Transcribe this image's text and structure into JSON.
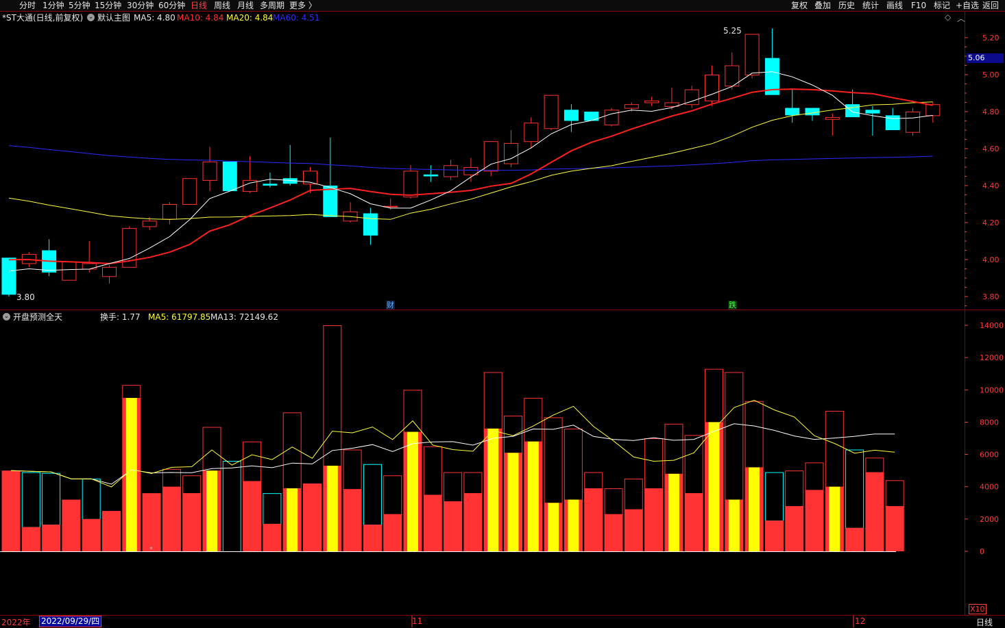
{
  "nav": {
    "periods": [
      "分时",
      "1分钟",
      "5分钟",
      "15分钟",
      "30分钟",
      "60分钟",
      "日线",
      "周线",
      "月线",
      "多周期",
      "更多 〉"
    ],
    "active_period": "日线",
    "tools": [
      "复权",
      "叠加",
      "历史",
      "统计",
      "画线",
      "F10",
      "标记",
      "+自选",
      "返回"
    ]
  },
  "main_info": {
    "title": "*ST大通(日线,前复权)",
    "template": "默认主图",
    "ma5": "MA5: 4.80",
    "ma10": "MA10: 4.84",
    "ma20": "MA20: 4.84",
    "ma60": "MA60: 4.51"
  },
  "sub_info": {
    "indicator": "开盘预测全天",
    "turnover": "换手: 1.77",
    "ma5": "MA5: 61797.85",
    "ma13": "MA13: 72149.62"
  },
  "annotations": {
    "high_label": "5.25",
    "low_label": "3.80",
    "marker_cai": "财",
    "marker_die": "跌",
    "current_price": "5.06",
    "sub_marker": "*"
  },
  "bottom": {
    "year": "2022年",
    "cursor_date": "2022/09/29/四",
    "month_11": "11",
    "month_12": "12",
    "period_label": "日线",
    "zoom": "X10"
  },
  "colors": {
    "up": "#ff3333",
    "down": "#00ffff",
    "ma5": "#ffffff",
    "ma10": "#ff2020",
    "ma20": "#ffff40",
    "ma60": "#2a2aff",
    "axis": "#ff3b3b",
    "yellow_bar": "#ffff00"
  },
  "chart_data": [
    {
      "type": "candlestick",
      "price_axis": {
        "ticks": [
          "5.20",
          "5.00",
          "4.80",
          "4.60",
          "4.40",
          "4.20",
          "4.00",
          "3.80"
        ],
        "range": [
          3.76,
          5.32
        ]
      },
      "candles": [
        [
          4.01,
          4.01,
          3.8,
          3.81
        ],
        [
          3.98,
          4.04,
          3.96,
          4.03
        ],
        [
          4.05,
          4.11,
          3.91,
          3.93
        ],
        [
          3.89,
          3.99,
          3.89,
          3.99
        ],
        [
          3.95,
          4.1,
          3.93,
          3.98
        ],
        [
          3.91,
          3.97,
          3.87,
          3.96
        ],
        [
          3.96,
          4.18,
          3.96,
          4.17
        ],
        [
          4.18,
          4.23,
          4.16,
          4.21
        ],
        [
          4.22,
          4.31,
          4.19,
          4.3
        ],
        [
          4.3,
          4.44,
          4.3,
          4.44
        ],
        [
          4.43,
          4.61,
          4.37,
          4.53
        ],
        [
          4.53,
          4.53,
          4.37,
          4.37
        ],
        [
          4.37,
          4.56,
          4.36,
          4.43
        ],
        [
          4.41,
          4.47,
          4.39,
          4.4
        ],
        [
          4.44,
          4.62,
          4.4,
          4.41
        ],
        [
          4.41,
          4.5,
          4.36,
          4.48
        ],
        [
          4.4,
          4.66,
          4.25,
          4.23
        ],
        [
          4.21,
          4.31,
          4.2,
          4.26
        ],
        [
          4.25,
          4.28,
          4.08,
          4.13
        ],
        [
          4.29,
          4.33,
          4.27,
          4.29
        ],
        [
          4.34,
          4.51,
          4.33,
          4.48
        ],
        [
          4.46,
          4.51,
          4.42,
          4.45
        ],
        [
          4.45,
          4.54,
          4.43,
          4.51
        ],
        [
          4.46,
          4.55,
          4.42,
          4.5
        ],
        [
          4.48,
          4.64,
          4.45,
          4.64
        ],
        [
          4.52,
          4.7,
          4.5,
          4.63
        ],
        [
          4.64,
          4.77,
          4.6,
          4.74
        ],
        [
          4.71,
          4.89,
          4.7,
          4.89
        ],
        [
          4.81,
          4.84,
          4.69,
          4.75
        ],
        [
          4.8,
          4.8,
          4.75,
          4.75
        ],
        [
          4.73,
          4.82,
          4.72,
          4.81
        ],
        [
          4.82,
          4.85,
          4.8,
          4.84
        ],
        [
          4.85,
          4.88,
          4.83,
          4.86
        ],
        [
          4.83,
          4.93,
          4.81,
          4.85
        ],
        [
          4.84,
          4.94,
          4.82,
          4.92
        ],
        [
          4.86,
          5.05,
          4.83,
          5.0
        ],
        [
          4.94,
          5.12,
          4.92,
          5.05
        ],
        [
          5.0,
          5.21,
          4.98,
          5.22
        ],
        [
          5.09,
          5.25,
          4.9,
          4.89
        ],
        [
          4.82,
          4.92,
          4.74,
          4.78
        ],
        [
          4.82,
          4.82,
          4.75,
          4.78
        ],
        [
          4.76,
          4.79,
          4.67,
          4.77
        ],
        [
          4.84,
          4.92,
          4.8,
          4.77
        ],
        [
          4.81,
          4.83,
          4.67,
          4.79
        ],
        [
          4.78,
          4.82,
          4.7,
          4.7
        ],
        [
          4.69,
          4.82,
          4.67,
          4.8
        ],
        [
          4.78,
          4.85,
          4.74,
          4.84
        ]
      ]
    },
    {
      "type": "bar",
      "name": "开盘预测全天",
      "y_axis": {
        "ticks": [
          "14000",
          "12000",
          "10000",
          "8000",
          "6000",
          "4000",
          "2000",
          "0"
        ],
        "range": [
          0,
          14000
        ]
      },
      "bars": [
        [
          5000,
          5000,
          "u"
        ],
        [
          1500,
          4900,
          "d"
        ],
        [
          1650,
          4850,
          "d"
        ],
        [
          3200,
          3200,
          "u"
        ],
        [
          2000,
          4500,
          "d"
        ],
        [
          2500,
          2500,
          "u"
        ],
        [
          9500,
          10300,
          "y"
        ],
        [
          3600,
          3600,
          "u"
        ],
        [
          4000,
          5100,
          "u"
        ],
        [
          3600,
          4700,
          "u"
        ],
        [
          5000,
          7700,
          "y"
        ],
        [
          0,
          5600,
          "d"
        ],
        [
          4350,
          6800,
          "u"
        ],
        [
          1700,
          3600,
          "d"
        ],
        [
          3900,
          8600,
          "y"
        ],
        [
          4200,
          4200,
          "u"
        ],
        [
          5300,
          14000,
          "y"
        ],
        [
          3850,
          6300,
          "u"
        ],
        [
          1650,
          5400,
          "d"
        ],
        [
          2300,
          4700,
          "u"
        ],
        [
          7400,
          10000,
          "y"
        ],
        [
          3500,
          6500,
          "u"
        ],
        [
          3100,
          4900,
          "u"
        ],
        [
          3600,
          4900,
          "u"
        ],
        [
          7600,
          11100,
          "y"
        ],
        [
          6100,
          8400,
          "y"
        ],
        [
          6800,
          9500,
          "y"
        ],
        [
          3000,
          8300,
          "y"
        ],
        [
          3200,
          7600,
          "y"
        ],
        [
          3900,
          4900,
          "u"
        ],
        [
          2300,
          3900,
          "u"
        ],
        [
          2600,
          4500,
          "u"
        ],
        [
          3900,
          7000,
          "u"
        ],
        [
          4800,
          7900,
          "y"
        ],
        [
          3600,
          7200,
          "u"
        ],
        [
          8000,
          11300,
          "y"
        ],
        [
          3200,
          11100,
          "y"
        ],
        [
          5200,
          9300,
          "y"
        ],
        [
          1900,
          4900,
          "d"
        ],
        [
          2800,
          5000,
          "u"
        ],
        [
          3800,
          5500,
          "u"
        ],
        [
          4000,
          8700,
          "y"
        ],
        [
          1450,
          6300,
          "d"
        ],
        [
          4900,
          5800,
          "u"
        ],
        [
          2800,
          4400,
          "u"
        ]
      ]
    }
  ]
}
